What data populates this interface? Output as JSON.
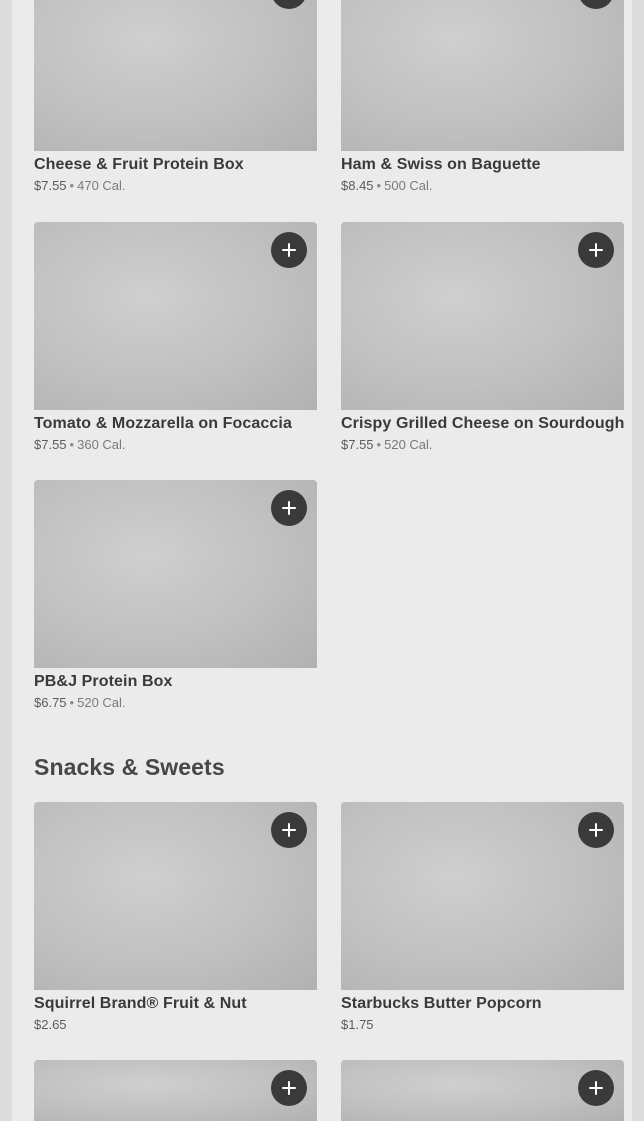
{
  "sections": [
    {
      "title": "",
      "items": [
        {
          "name": "Cheese & Fruit Protein Box",
          "price": "$7.55",
          "calories": "470 Cal."
        },
        {
          "name": "Ham & Swiss on Baguette",
          "price": "$8.45",
          "calories": "500 Cal."
        },
        {
          "name": "Tomato & Mozzarella on Focaccia",
          "price": "$7.55",
          "calories": "360 Cal."
        },
        {
          "name": "Crispy Grilled Cheese on Sourdough",
          "price": "$7.55",
          "calories": "520 Cal."
        },
        {
          "name": "PB&J Protein Box",
          "price": "$6.75",
          "calories": "520 Cal."
        }
      ]
    },
    {
      "title": "Snacks & Sweets",
      "items": [
        {
          "name": "Squirrel Brand® Fruit & Nut",
          "price": "$2.65"
        },
        {
          "name": "Starbucks Butter Popcorn",
          "price": "$1.75"
        },
        {
          "name": "",
          "price": ""
        },
        {
          "name": "",
          "price": ""
        }
      ]
    }
  ],
  "icons": {
    "add_button": "plus-icon"
  },
  "colors": {
    "add_button_bg": "#3a3a3a",
    "page_bg": "#ebebeb",
    "thumb_placeholder": "#c0c0c0"
  }
}
